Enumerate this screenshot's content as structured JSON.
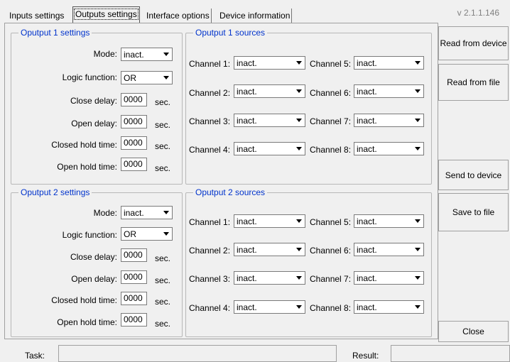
{
  "tabs": [
    "Inputs settings",
    "Outputs settings",
    "Interface options",
    "Device information"
  ],
  "version": "v 2.1.1.146",
  "unit": "sec.",
  "labels": {
    "mode": "Mode:",
    "logic": "Logic function:",
    "close_delay": "Close delay:",
    "open_delay": "Open delay:",
    "closed_hold": "Closed hold time:",
    "open_hold": "Open hold time:"
  },
  "outputs": [
    {
      "settings_title": "Oputput 1 settings",
      "sources_title": "Oputput 1 sources",
      "mode": "inact.",
      "logic": "OR",
      "close_delay": "0000",
      "open_delay": "0000",
      "closed_hold": "0000",
      "open_hold": "0000",
      "channels": [
        {
          "label": "Channel 1:",
          "value": "inact."
        },
        {
          "label": "Channel 2:",
          "value": "inact."
        },
        {
          "label": "Channel 3:",
          "value": "inact."
        },
        {
          "label": "Channel 4:",
          "value": "inact."
        },
        {
          "label": "Channel 5:",
          "value": "inact."
        },
        {
          "label": "Channel 6:",
          "value": "inact."
        },
        {
          "label": "Channel 7:",
          "value": "inact."
        },
        {
          "label": "Channel 8:",
          "value": "inact."
        }
      ]
    },
    {
      "settings_title": "Oputput 2 settings",
      "sources_title": "Oputput 2 sources",
      "mode": "inact.",
      "logic": "OR",
      "close_delay": "0000",
      "open_delay": "0000",
      "closed_hold": "0000",
      "open_hold": "0000",
      "channels": [
        {
          "label": "Channel 1:",
          "value": "inact."
        },
        {
          "label": "Channel 2:",
          "value": "inact."
        },
        {
          "label": "Channel 3:",
          "value": "inact."
        },
        {
          "label": "Channel 4:",
          "value": "inact."
        },
        {
          "label": "Channel 5:",
          "value": "inact."
        },
        {
          "label": "Channel 6:",
          "value": "inact."
        },
        {
          "label": "Channel 7:",
          "value": "inact."
        },
        {
          "label": "Channel 8:",
          "value": "inact."
        }
      ]
    }
  ],
  "buttons": {
    "read_device": "Read from device",
    "read_file": "Read from file",
    "send_device": "Send to device",
    "save_file": "Save to file",
    "close": "Close"
  },
  "status": {
    "task_label": "Task:",
    "result_label": "Result:"
  }
}
